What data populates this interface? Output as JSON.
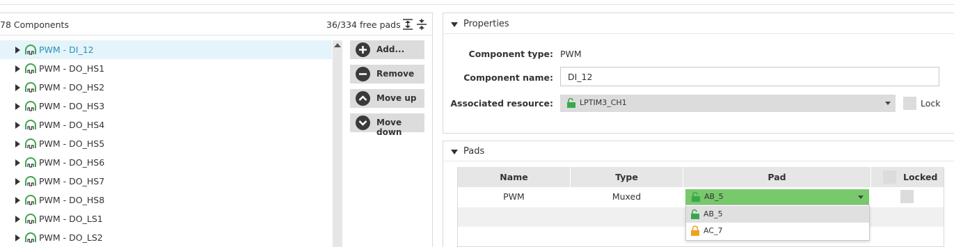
{
  "left": {
    "component_count": "78 Components",
    "free_pads": "36/334 free pads",
    "components": [
      {
        "label": "PWM - DI_12",
        "selected": true
      },
      {
        "label": "PWM - DO_HS1"
      },
      {
        "label": "PWM - DO_HS2"
      },
      {
        "label": "PWM - DO_HS3"
      },
      {
        "label": "PWM - DO_HS4"
      },
      {
        "label": "PWM - DO_HS5"
      },
      {
        "label": "PWM - DO_HS6"
      },
      {
        "label": "PWM - DO_HS7"
      },
      {
        "label": "PWM - DO_HS8"
      },
      {
        "label": "PWM - DO_LS1"
      },
      {
        "label": "PWM - DO_LS2"
      }
    ],
    "buttons": {
      "add": "Add...",
      "remove": "Remove",
      "move_up": "Move up",
      "move_down": "Move down"
    }
  },
  "properties": {
    "section_title": "Properties",
    "component_type_label": "Component type:",
    "component_type_value": "PWM",
    "component_name_label": "Component name:",
    "component_name_value": "DI_12",
    "associated_resource_label": "Associated resource:",
    "associated_resource_value": "LPTIM3_CH1",
    "lock_label": "Lock"
  },
  "pads": {
    "section_title": "Pads",
    "columns": [
      "Name",
      "Type",
      "Pad",
      "Locked"
    ],
    "rows": [
      {
        "name": "PWM",
        "type": "Muxed",
        "pad": "AB_5"
      }
    ],
    "dropdown_options": [
      "AB_5",
      "AC_7"
    ]
  },
  "colors": {
    "selected_row_bg": "#e4f4fa",
    "selected_text": "#2a8fb8",
    "pad_select_bg": "#77c96b",
    "lock_green": "#3aa84a",
    "lock_orange": "#f0a020"
  }
}
